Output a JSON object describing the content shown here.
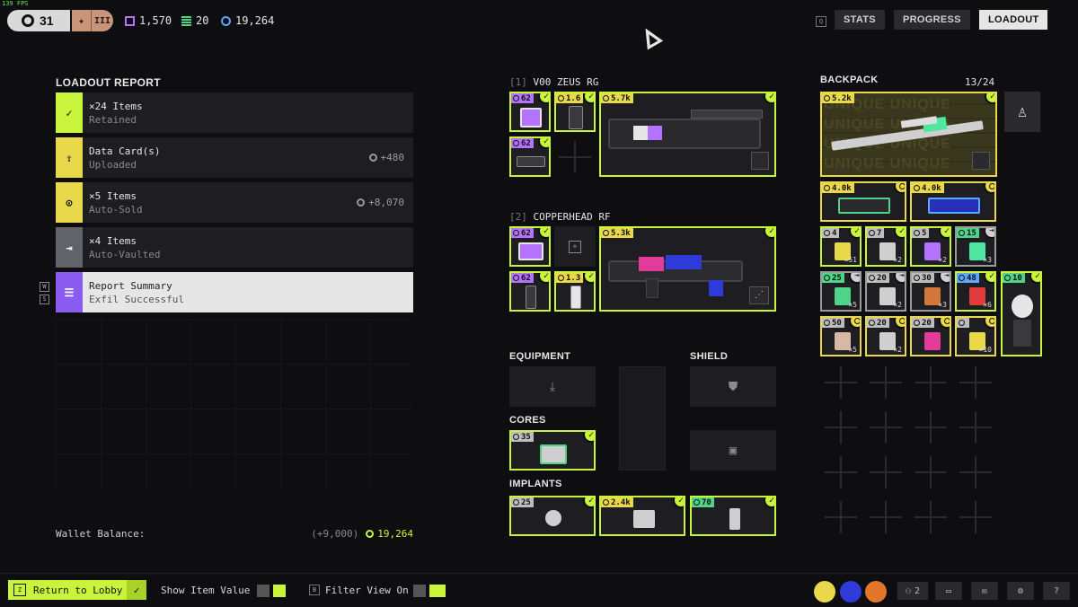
{
  "fps": "139 FPS",
  "player": {
    "level": "31",
    "rank": "III"
  },
  "currencies": [
    {
      "icon": "purple-square-icon",
      "value": "1,570"
    },
    {
      "icon": "green-stack-icon",
      "value": "20"
    },
    {
      "icon": "blue-coin-icon",
      "value": "19,264"
    }
  ],
  "nav": {
    "key": "Q",
    "stats": "STATS",
    "progress": "PROGRESS",
    "loadout": "LOADOUT"
  },
  "report": {
    "title": "LOADOUT REPORT",
    "rows": [
      {
        "icon": "check-icon",
        "line1": "×24 Items",
        "line2": "Retained",
        "value": ""
      },
      {
        "icon": "upload-icon",
        "line1": "Data Card(s)",
        "line2": "Uploaded",
        "value": "+480"
      },
      {
        "icon": "sold-icon",
        "line1": "×5 Items",
        "line2": "Auto-Sold",
        "value": "+8,070"
      },
      {
        "icon": "vault-icon",
        "line1": "×4 Items",
        "line2": "Auto-Vaulted",
        "value": ""
      },
      {
        "icon": "list-icon",
        "line1": "Report Summary",
        "line2": "Exfil Successful",
        "value": ""
      }
    ],
    "keys": [
      "W",
      "S"
    ]
  },
  "wallet": {
    "label": "Wallet Balance:",
    "delta": "(+9,000)",
    "balance": "19,264"
  },
  "weapons": [
    {
      "index": "[1]",
      "name": "V00 ZEUS RG"
    },
    {
      "index": "[2]",
      "name": "COPPERHEAD RF"
    }
  ],
  "slots": {
    "w1_a": "62",
    "w1_b": "1.6",
    "w1_main": "5.7k",
    "w1_c": "62",
    "w2_a": "62",
    "w2_main": "5.3k",
    "w2_c": "62",
    "w2_d": "1.3"
  },
  "sections": {
    "equipment": "EQUIPMENT",
    "shield": "SHIELD",
    "cores": "CORES",
    "implants": "IMPLANTS",
    "backpack": "BACKPACK",
    "backpack_count": "13/24"
  },
  "cores": {
    "value": "35"
  },
  "implants": [
    "25",
    "2.4k",
    "70"
  ],
  "backpack": {
    "unique_text": "UNIQUE UNIQUE",
    "main": "5.2k",
    "row2": [
      "4.0k",
      "4.0k"
    ],
    "items": [
      {
        "price": "4",
        "color": "gray",
        "badge": "check",
        "qty": "×51"
      },
      {
        "price": "7",
        "color": "gray",
        "badge": "check",
        "qty": "×2"
      },
      {
        "price": "5",
        "color": "gray",
        "badge": "check",
        "qty": "×2"
      },
      {
        "price": "15",
        "color": "green",
        "badge": "vault",
        "qty": "×3"
      },
      {
        "price": "25",
        "color": "green",
        "badge": "vault",
        "qty": "×5"
      },
      {
        "price": "20",
        "color": "gray",
        "badge": "vault",
        "qty": "×2"
      },
      {
        "price": "30",
        "color": "gray",
        "badge": "vault",
        "qty": "×3"
      },
      {
        "price": "48",
        "color": "blue",
        "badge": "check",
        "qty": "×6"
      },
      {
        "price": "50",
        "color": "gray",
        "badge": "coin",
        "qty": "×5"
      },
      {
        "price": "20",
        "color": "gray",
        "badge": "coin",
        "qty": "×2"
      },
      {
        "price": "20",
        "color": "gray",
        "badge": "coin",
        "qty": ""
      },
      {
        "price": "",
        "color": "gray",
        "badge": "coin",
        "qty": "×10"
      }
    ],
    "tall_item": "10"
  },
  "bottom": {
    "return_key": "Z",
    "return_label": "Return to Lobby",
    "show_value": "Show Item Value",
    "filter_key": "B",
    "filter_label": "Filter View On",
    "party_count": "2"
  },
  "colors": {
    "accent": "#c8f53c",
    "purple": "#b473ff",
    "yellow": "#e8d84a",
    "gray": "#62626a"
  }
}
